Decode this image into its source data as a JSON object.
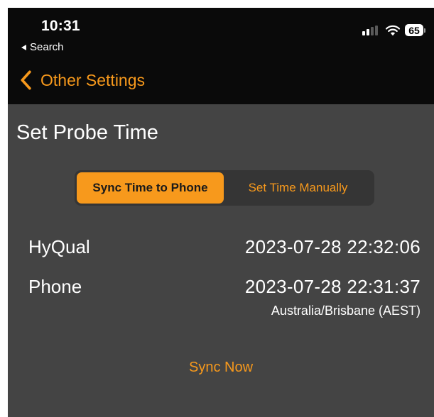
{
  "status_bar": {
    "time": "10:31",
    "back_app_label": "Search",
    "battery_level": "65",
    "signal_bars_active": 2,
    "signal_bars_total": 4
  },
  "nav": {
    "back_label": "Other Settings"
  },
  "page": {
    "title": "Set Probe Time"
  },
  "mode_selector": {
    "options": [
      "Sync Time to Phone",
      "Set Time Manually"
    ],
    "selected": "Sync Time to Phone"
  },
  "times": {
    "device_label": "HyQual",
    "device_time": "2023-07-28 22:32:06",
    "phone_label": "Phone",
    "phone_time": "2023-07-28 22:31:37",
    "timezone": "Australia/Brisbane (AEST)"
  },
  "actions": {
    "sync_now": "Sync Now"
  },
  "colors": {
    "accent": "#f7991c",
    "background": "#444444",
    "bar_background": "#0a0a0a",
    "segment_background": "#353535",
    "text": "#ffffff"
  }
}
